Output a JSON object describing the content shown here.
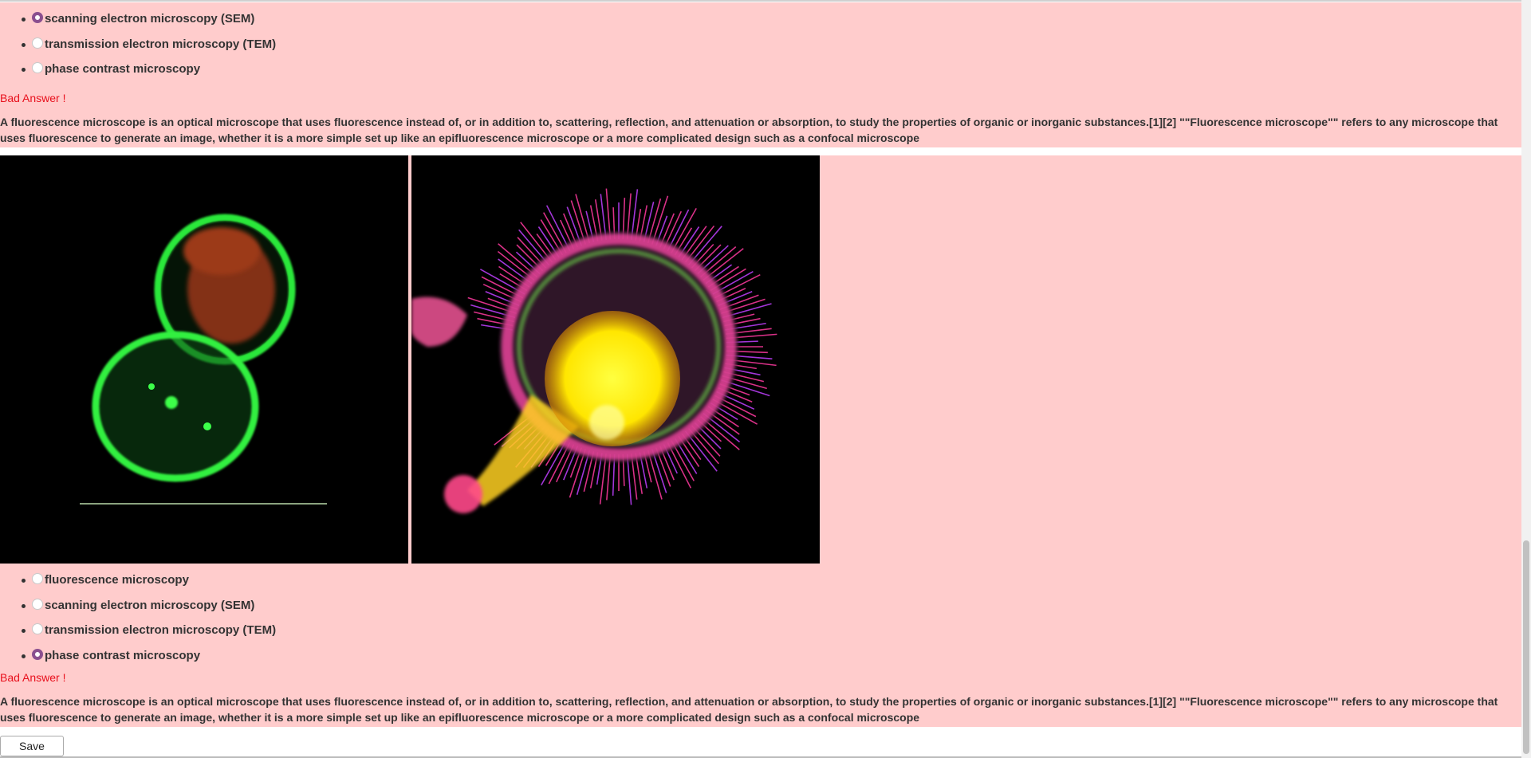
{
  "question1": {
    "options": [
      {
        "label": "scanning electron microscopy (SEM)",
        "checked": true
      },
      {
        "label": "transmission electron microscopy (TEM)",
        "checked": false
      },
      {
        "label": "phase contrast microscopy",
        "checked": false
      }
    ],
    "feedback": "Bad Answer !",
    "explanation": "A fluorescence microscope is an optical microscope that uses fluorescence instead of, or in addition to, scattering, reflection, and attenuation or absorption, to study the properties of organic or inorganic substances.[1][2] \"\"Fluorescence microscope\"\" refers to any microscope that uses fluorescence to generate an image, whether it is a more simple set up like an epifluorescence microscope or a more complicated design such as a confocal microscope"
  },
  "question2": {
    "images": [
      {
        "icon": "fluorescence-cells-image"
      },
      {
        "icon": "fluorescence-filopodia-cell-image"
      }
    ],
    "options": [
      {
        "label": "fluorescence microscopy",
        "checked": false
      },
      {
        "label": "scanning electron microscopy (SEM)",
        "checked": false
      },
      {
        "label": "transmission electron microscopy (TEM)",
        "checked": false
      },
      {
        "label": "phase contrast microscopy",
        "checked": true
      }
    ],
    "feedback": "Bad Answer !",
    "explanation": "A fluorescence microscope is an optical microscope that uses fluorescence instead of, or in addition to, scattering, reflection, and attenuation or absorption, to study the properties of organic or inorganic substances.[1][2] \"\"Fluorescence microscope\"\" refers to any microscope that uses fluorescence to generate an image, whether it is a more simple set up like an epifluorescence microscope or a more complicated design such as a confocal microscope"
  },
  "save_label": "Save",
  "colors": {
    "panel_bg": "#ffcccc",
    "error": "#e8101c",
    "radio_checked": "#8a4f8f"
  }
}
